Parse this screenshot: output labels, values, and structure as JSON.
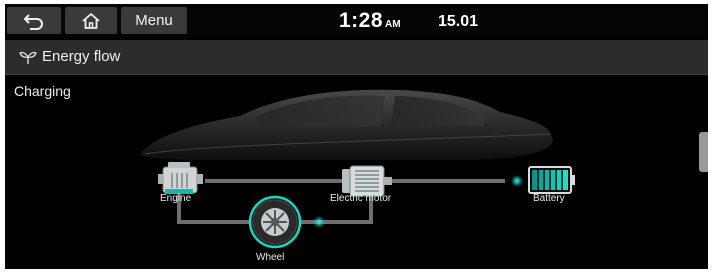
{
  "topbar": {
    "back_icon": "back-arrow-icon",
    "home_icon": "home-icon",
    "menu_label": "Menu",
    "time": "1:28",
    "ampm": "AM",
    "date": "15.01"
  },
  "titlebar": {
    "icon": "eco-leaf-icon",
    "title": "Energy flow"
  },
  "status": "Charging",
  "flow": {
    "engine_label": "Engine",
    "motor_label": "Electric motor",
    "battery_label": "Battery",
    "wheel_label": "Wheel"
  },
  "colors": {
    "accent": "#19d6c2",
    "background": "#000000",
    "button": "#3a3a3a",
    "titlebar": "#2c2c2c"
  }
}
